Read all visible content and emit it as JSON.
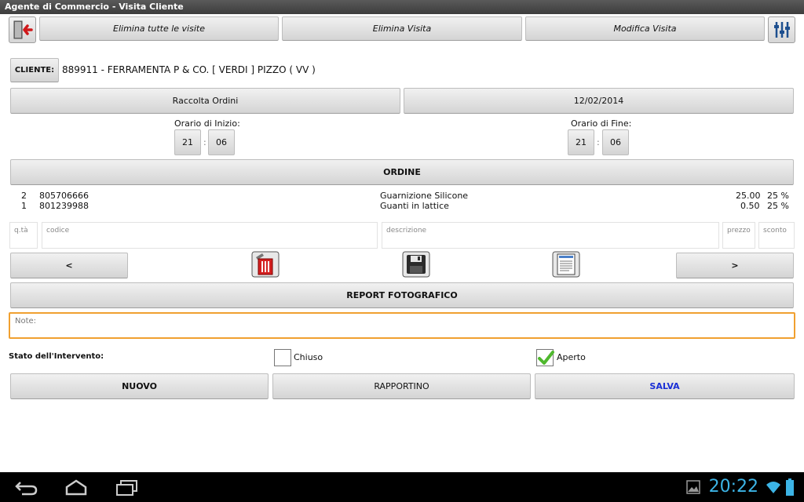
{
  "window": {
    "title": "Agente di Commercio - Visita Cliente"
  },
  "toolbar": {
    "delete_all": "Elimina tutte le visite",
    "delete_visit": "Elimina Visita",
    "edit_visit": "Modifica Visita"
  },
  "client": {
    "button_label": "CLIENTE:",
    "value": "889911 - FERRAMENTA P & CO. [ VERDI ] PIZZO ( VV )"
  },
  "visit": {
    "type": "Raccolta Ordini",
    "date": "12/02/2014",
    "start_label": "Orario di Inizio:",
    "start_hour": "21",
    "start_min": "06",
    "end_label": "Orario di Fine:",
    "end_hour": "21",
    "end_min": "06",
    "time_sep": ":"
  },
  "order": {
    "title": "ORDINE",
    "rows": [
      {
        "qty": "2",
        "code": "805706666",
        "desc": "Guarnizione Silicone",
        "price": "25.00",
        "discount": "25 %"
      },
      {
        "qty": "1",
        "code": "801239988",
        "desc": "Guanti in lattice",
        "price": "0.50",
        "discount": "25 %"
      }
    ],
    "placeholders": {
      "qty": "q.tà",
      "code": "codice",
      "desc": "descrizione",
      "price": "prezzo",
      "discount": "sconto"
    },
    "prev": "<",
    "next": ">"
  },
  "report": {
    "label": "REPORT FOTOGRAFICO"
  },
  "notes": {
    "placeholder": "Note:"
  },
  "status": {
    "label": "Stato dell'Intervento:",
    "closed_label": "Chiuso",
    "closed_checked": false,
    "open_label": "Aperto",
    "open_checked": true
  },
  "actions": {
    "new": "NUOVO",
    "report": "RAPPORTINO",
    "save": "SALVA",
    "save_color": "#1a2fd6"
  },
  "system": {
    "clock": "20:22",
    "accent": "#3cb4e6"
  }
}
